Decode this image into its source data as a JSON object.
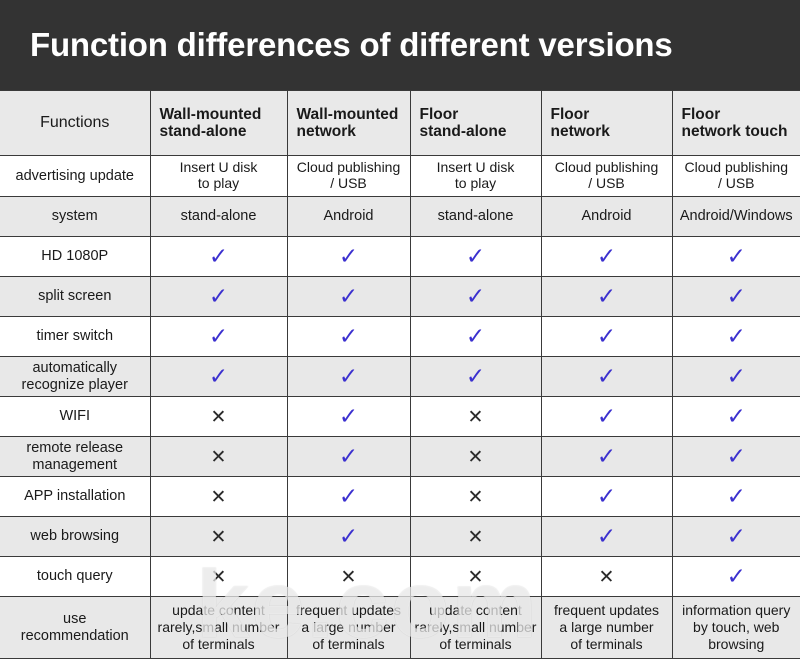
{
  "banner": {
    "title": "Function differences of different versions"
  },
  "table": {
    "columns": [
      {
        "id": "functions",
        "label": "Functions"
      },
      {
        "id": "wall-stand-alone",
        "line1": "Wall-mounted",
        "line2": "stand-alone"
      },
      {
        "id": "wall-network",
        "line1": "Wall-mounted",
        "line2": "network"
      },
      {
        "id": "floor-stand-alone",
        "line1": "Floor",
        "line2": "stand-alone"
      },
      {
        "id": "floor-network",
        "line1": "Floor",
        "line2": "network"
      },
      {
        "id": "floor-network-touch",
        "line1": "Floor",
        "line2": "network touch"
      }
    ],
    "rows": [
      {
        "label": "advertising update",
        "type": "text",
        "cells": [
          {
            "line1": "Insert U disk",
            "line2": "to play"
          },
          {
            "line1": "Cloud publishing",
            "line2": "/ USB"
          },
          {
            "line1": "Insert U disk",
            "line2": "to play"
          },
          {
            "line1": "Cloud publishing",
            "line2": "/ USB"
          },
          {
            "line1": "Cloud publishing",
            "line2": "/ USB"
          }
        ]
      },
      {
        "label": "system",
        "type": "text",
        "cells": [
          {
            "line1": "stand-alone"
          },
          {
            "line1": "Android"
          },
          {
            "line1": "stand-alone"
          },
          {
            "line1": "Android"
          },
          {
            "line1": "Android/Windows"
          }
        ]
      },
      {
        "label": "HD 1080P",
        "type": "mark",
        "marks": [
          "yes",
          "yes",
          "yes",
          "yes",
          "yes"
        ]
      },
      {
        "label": "split screen",
        "type": "mark",
        "marks": [
          "yes",
          "yes",
          "yes",
          "yes",
          "yes"
        ]
      },
      {
        "label": "timer switch",
        "type": "mark",
        "marks": [
          "yes",
          "yes",
          "yes",
          "yes",
          "yes"
        ]
      },
      {
        "label": "automatically\nrecognize player",
        "label_line1": "automatically",
        "label_line2": "recognize player",
        "type": "mark",
        "marks": [
          "yes",
          "yes",
          "yes",
          "yes",
          "yes"
        ]
      },
      {
        "label": "WIFI",
        "type": "mark",
        "marks": [
          "no",
          "yes",
          "no",
          "yes",
          "yes"
        ]
      },
      {
        "label_line1": "remote release",
        "label_line2": "management",
        "type": "mark",
        "marks": [
          "no",
          "yes",
          "no",
          "yes",
          "yes"
        ]
      },
      {
        "label": "APP installation",
        "type": "mark",
        "marks": [
          "no",
          "yes",
          "no",
          "yes",
          "yes"
        ]
      },
      {
        "label": "web browsing",
        "type": "mark",
        "marks": [
          "no",
          "yes",
          "no",
          "yes",
          "yes"
        ]
      },
      {
        "label": "touch query",
        "type": "mark",
        "marks": [
          "no",
          "no",
          "no",
          "no",
          "yes"
        ]
      },
      {
        "label_line1": "use",
        "label_line2": "recommendation",
        "type": "text3",
        "cells": [
          {
            "line1": "update content",
            "line2": "rarely,small number",
            "line3": "of terminals"
          },
          {
            "line1": "frequent updates",
            "line2": "a large number",
            "line3": "of terminals"
          },
          {
            "line1": "update content",
            "line2": "rarely,small number",
            "line3": "of terminals"
          },
          {
            "line1": "frequent updates",
            "line2": "a large number",
            "line3": "of terminals"
          },
          {
            "line1": "information query",
            "line2": "by touch, web",
            "line3": "browsing"
          }
        ]
      }
    ]
  },
  "marks": {
    "yes": "✓",
    "no": "✕"
  },
  "watermark": {
    "text": "ke.com"
  },
  "colors": {
    "banner_bg": "#333333",
    "banner_text": "#ffffff",
    "check": "#3b30cf",
    "cross": "#2b2b2b",
    "row_alt": "#e8e8e8",
    "row_white": "#ffffff",
    "header_bg": "#e9e9e9",
    "border": "#3a3a3a"
  }
}
